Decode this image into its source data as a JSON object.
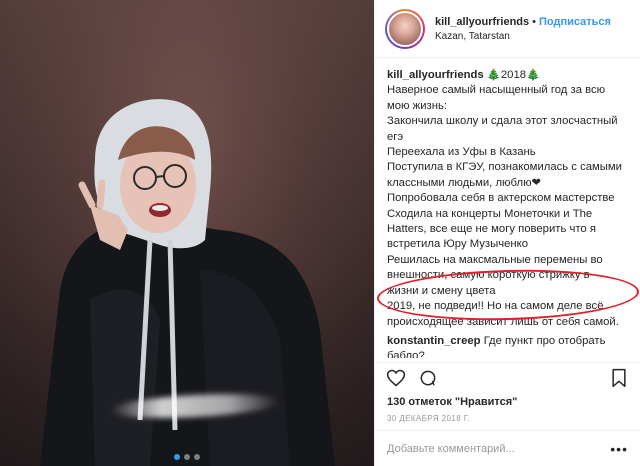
{
  "header": {
    "username": "kill_allyourfriends",
    "separator": "•",
    "follow_label": "Подписаться",
    "location": "Kazan, Tatarstan"
  },
  "caption": {
    "username": "kill_allyourfriends",
    "title": "🎄2018🎄",
    "lines": [
      "Наверное самый насыщенный год за всю",
      "мою жизнь:",
      "Закончила школу и сдала этот злосчастный",
      "егэ",
      "Переехала из Уфы в Казань",
      "Поступила в КГЭУ, познакомилась с самыми",
      "классными людьми, люблю❤",
      "Попробовала себя в актерском мастерстве",
      "Сходила на концерты Монеточки и The",
      "Hatters, все еще не могу поверить что я",
      "встретила Юру Музыченко",
      "Решилась на максмальные перемены во",
      "внешности, самую короткую стрижку в",
      "жизни и смену цвета",
      "2019, не подведи!! Но на самом деле всё",
      "происходящее зависит лишь от себя самой."
    ]
  },
  "comment": {
    "username": "konstantin_creep",
    "text": "Где пункт про отобрать бабло?"
  },
  "likes": "130 отметок \"Нравится\"",
  "date": "30 ДЕКАБРЯ 2018 Г.",
  "add_comment": {
    "placeholder": "Добавьте комментарий...",
    "more": "•••"
  },
  "icons": {
    "like": "heart-icon",
    "comment": "comment-icon",
    "share": "share-icon",
    "save": "bookmark-icon"
  },
  "colors": {
    "accent": "#3897f0",
    "highlight": "#e3202a",
    "text": "#262626",
    "muted": "#999999"
  }
}
